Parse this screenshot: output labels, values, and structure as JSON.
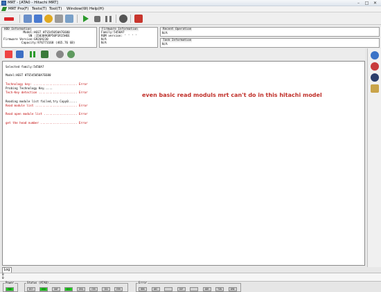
{
  "window": {
    "title": "MRT - [ATA0 - Hitachi MRT]",
    "min": "–",
    "max": "□",
    "close": "✕"
  },
  "menu": [
    "MRT Pro(F)",
    "Tests(T)",
    "Tool(T)",
    "Window(W)",
    "Help(H)"
  ],
  "hdd_info": {
    "header": "HDD Information",
    "lines": [
      "           Model:HGST HTS545050A7E680",
      "              SN :150309GRP50P1R15HEE",
      "Firmware Version:GR2OA230",
      "          Capacity:976773168 (465.76 GB)"
    ]
  },
  "firmware_info": {
    "header": "Firmware Information",
    "lines": [
      "Family:5450A7",
      "ROM version: ' ' ' '",
      "N/A",
      "N/A"
    ]
  },
  "recent_operation": {
    "header": "Recent Operation",
    "value": "N/A"
  },
  "task_information": {
    "header": "Task Information",
    "value": "N/A"
  },
  "log_lines": [
    {
      "text": "Selected family:5450A7",
      "status": "",
      "error": false
    },
    {
      "text": "",
      "status": "",
      "error": false
    },
    {
      "text": "Model:HGST HTS545050A7E680",
      "status": "",
      "error": false
    },
    {
      "text": "",
      "status": "",
      "error": false
    },
    {
      "text": "Technology key:",
      "status": "Error",
      "error": true
    },
    {
      "text": "Probing Technology Key.....",
      "status": "",
      "error": false
    },
    {
      "text": "Tech-Key detection",
      "status": "Error",
      "error": true
    },
    {
      "text": "",
      "status": "",
      "error": false
    },
    {
      "text": "Reading module list failed,try Copy0.....",
      "status": "",
      "error": false
    },
    {
      "text": "Read module list",
      "status": "Error",
      "error": true
    },
    {
      "text": "",
      "status": "",
      "error": false
    },
    {
      "text": "Read open module list",
      "status": "Error",
      "error": true
    },
    {
      "text": "",
      "status": "",
      "error": false
    },
    {
      "text": "get the head number",
      "status": "Error",
      "error": true
    }
  ],
  "annotation": "even basic read moduls mrt can't do in this hitachi model",
  "log_tab": "Log",
  "status_rows": [
    "0",
    "0"
  ],
  "power": {
    "label": "Power",
    "leds": [
      {
        "label": "PWR",
        "on": true
      }
    ]
  },
  "status": {
    "label": "Status (ATA0)",
    "leds": [
      {
        "label": "BSY",
        "on": false
      },
      {
        "label": "DRD",
        "on": true
      },
      {
        "label": "DWF",
        "on": false
      },
      {
        "label": "DSC",
        "on": true
      },
      {
        "label": "DRQ",
        "on": false
      },
      {
        "label": "CRR",
        "on": false
      },
      {
        "label": "IDX",
        "on": false
      },
      {
        "label": "ERR",
        "on": false
      }
    ]
  },
  "error": {
    "label": "Error",
    "leds": [
      {
        "label": "BBK",
        "on": false
      },
      {
        "label": "UNC",
        "on": false
      },
      {
        "label": "",
        "on": false
      },
      {
        "label": "INF",
        "on": false
      },
      {
        "label": "",
        "on": false
      },
      {
        "label": "ABR",
        "on": false
      },
      {
        "label": "TON",
        "on": false
      },
      {
        "label": "AMN",
        "on": false
      }
    ]
  },
  "colors": {
    "accent_red": "#c0302a",
    "led_on": "#1fd41f",
    "error_text": "#c00000"
  }
}
